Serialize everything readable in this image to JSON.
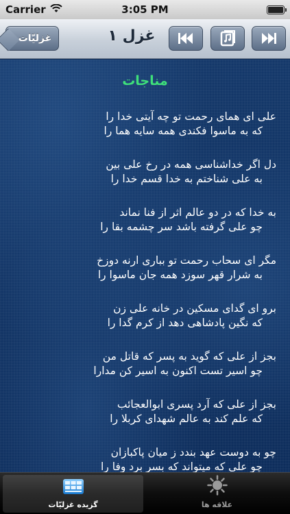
{
  "status_bar": {
    "carrier": "Carrier",
    "time": "3:05 PM",
    "battery_level": 1.0
  },
  "nav_bar": {
    "back_label": "غزلیّات",
    "title": "غزل ۱",
    "prev_icon": "skip-back-icon",
    "music_icon": "music-book-icon",
    "next_icon": "skip-forward-icon"
  },
  "poem": {
    "title": "مناجات",
    "couplets": [
      {
        "line1": "علی ای همای رحمت تو چه آیتی خدا را",
        "line2": "که به ماسوا فکندی همه سایه هما را"
      },
      {
        "line1": "دل اگر خداشناسی همه در رخ علی بین",
        "line2": "به علی شناختم به خدا قسم خدا را"
      },
      {
        "line1": "به خدا که در دو عالم اثر از فنا نماند",
        "line2": "چو علی گرفته باشد سر چشمه بقا را"
      },
      {
        "line1": "مگر ای سحاب رحمت تو بباری ارنه دوزخ",
        "line2": "به شرار قهر سوزد همه جان ماسوا را"
      },
      {
        "line1": "برو ای گدای مسکین در خانه علی زن",
        "line2": "که نگین پادشاهی دهد از کرم گدا را"
      },
      {
        "line1": "بجز از علی که گوید به پسر که قاتل من",
        "line2": "چو اسیر تست اکنون به اسیر کن مدارا"
      },
      {
        "line1": "بجز از علی که آرد پسری ابوالعجائب",
        "line2": "که علم کند به عالم شهدای کربلا را"
      },
      {
        "line1": "چو به دوست عهد بندد ز میان پاکبازان",
        "line2": "چو علی که میتواند که بسر برد وفا را"
      }
    ]
  },
  "tab_bar": {
    "tabs": [
      {
        "label": "گزیده غزلیّات",
        "icon": "book-grid-icon",
        "selected": true
      },
      {
        "label": "علاقه ها",
        "icon": "sun-icon",
        "selected": false
      }
    ]
  },
  "colors": {
    "poem_title": "#3fe07a",
    "background": "#0d2d5c",
    "nav_button": "#5d6f88"
  }
}
